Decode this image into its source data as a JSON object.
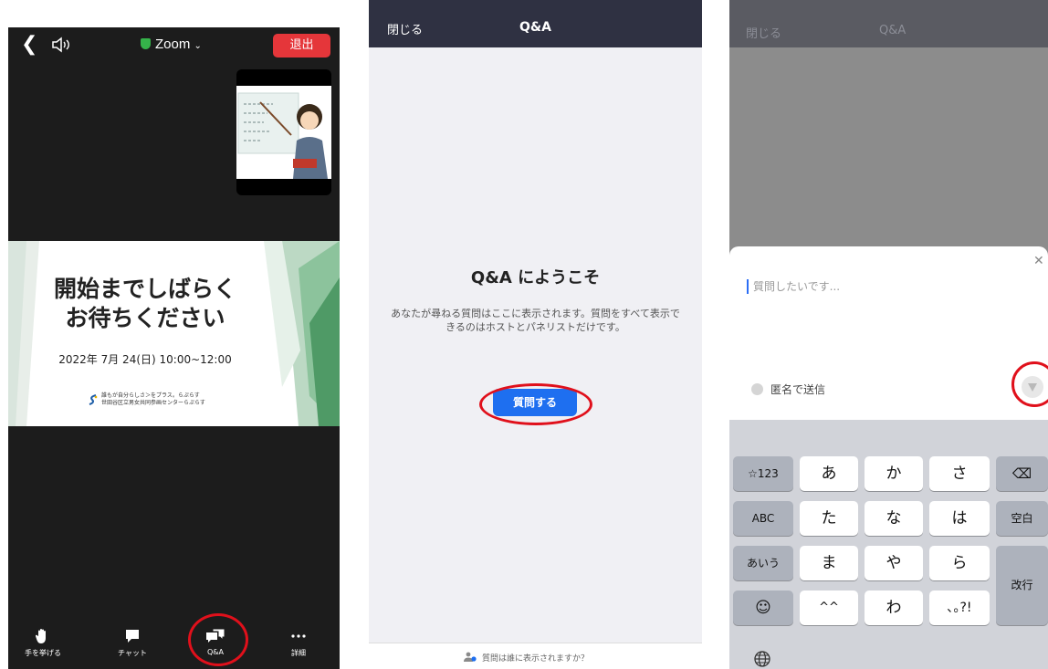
{
  "panel1": {
    "title": "Zoom",
    "exit_label": "退出",
    "slide": {
      "title_line1": "開始までしばらく",
      "title_line2": "お待ちください",
      "date": "2022年 7月 24(日) 10:00~12:00",
      "org_line1": "誰もが自分らしさ＞をプラス。らぷらす",
      "org_line2": "世田谷区立男女共同参画センターらぷらす"
    },
    "toolbar": [
      {
        "label": "手を挙げる",
        "icon": "raise-hand-icon"
      },
      {
        "label": "チャット",
        "icon": "chat-icon"
      },
      {
        "label": "Q&A",
        "icon": "qa-icon"
      },
      {
        "label": "詳細",
        "icon": "more-icon"
      }
    ],
    "colors": {
      "exit": "#e5363a",
      "highlight": "#e0101b",
      "shield": "#35b34a"
    }
  },
  "panel2": {
    "close_label": "閉じる",
    "title": "Q&A",
    "welcome": "Q&A にようこそ",
    "description": "あなたが尋ねる質問はここに表示されます。質問をすべて表示できるのはホストとパネリストだけです。",
    "ask_button": "質問する",
    "footer": "質問は誰に表示されますか？",
    "colors": {
      "header": "#2f3142",
      "button": "#1e6ff0"
    }
  },
  "panel3": {
    "close_label": "閉じる",
    "title": "Q&A",
    "input_placeholder": "質問したいです...",
    "anonymous_label": "匿名で送信",
    "keyboard": {
      "left_keys": [
        "☆123",
        "ABC",
        "あいう",
        "☺"
      ],
      "rows": [
        [
          "あ",
          "か",
          "さ"
        ],
        [
          "た",
          "な",
          "は"
        ],
        [
          "ま",
          "や",
          "ら"
        ],
        [
          "^^",
          "わ",
          "､｡?!"
        ]
      ],
      "backspace": "⌫",
      "space": "空白",
      "enter": "改行",
      "globe": "🌐"
    }
  }
}
